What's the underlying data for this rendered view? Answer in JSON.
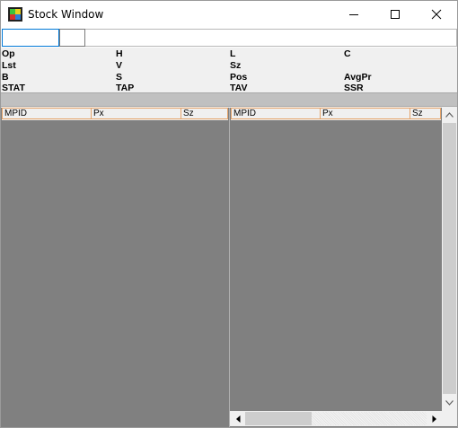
{
  "window": {
    "title": "Stock Window",
    "icon": "app-grid-icon",
    "controls": [
      "minimize-icon",
      "maximize-icon",
      "close-icon"
    ]
  },
  "toolbar": {
    "symbol_value": ""
  },
  "stats": {
    "row1": [
      "Op",
      "H",
      "L",
      "C"
    ],
    "row2": [
      "Lst",
      "V",
      "Sz"
    ],
    "row3": [
      "B",
      "S",
      "Pos",
      "AvgPr"
    ],
    "row4": [
      "STAT",
      "TAP",
      "TAV",
      "SSR"
    ]
  },
  "left_grid": {
    "columns": [
      "MPID",
      "Px",
      "Sz"
    ]
  },
  "right_grid": {
    "columns": [
      "MPID",
      "Px",
      "Sz"
    ]
  },
  "colors": {
    "pane_background": "#808080",
    "header_border": "#e6a46a",
    "input_focus": "#0078d7"
  }
}
